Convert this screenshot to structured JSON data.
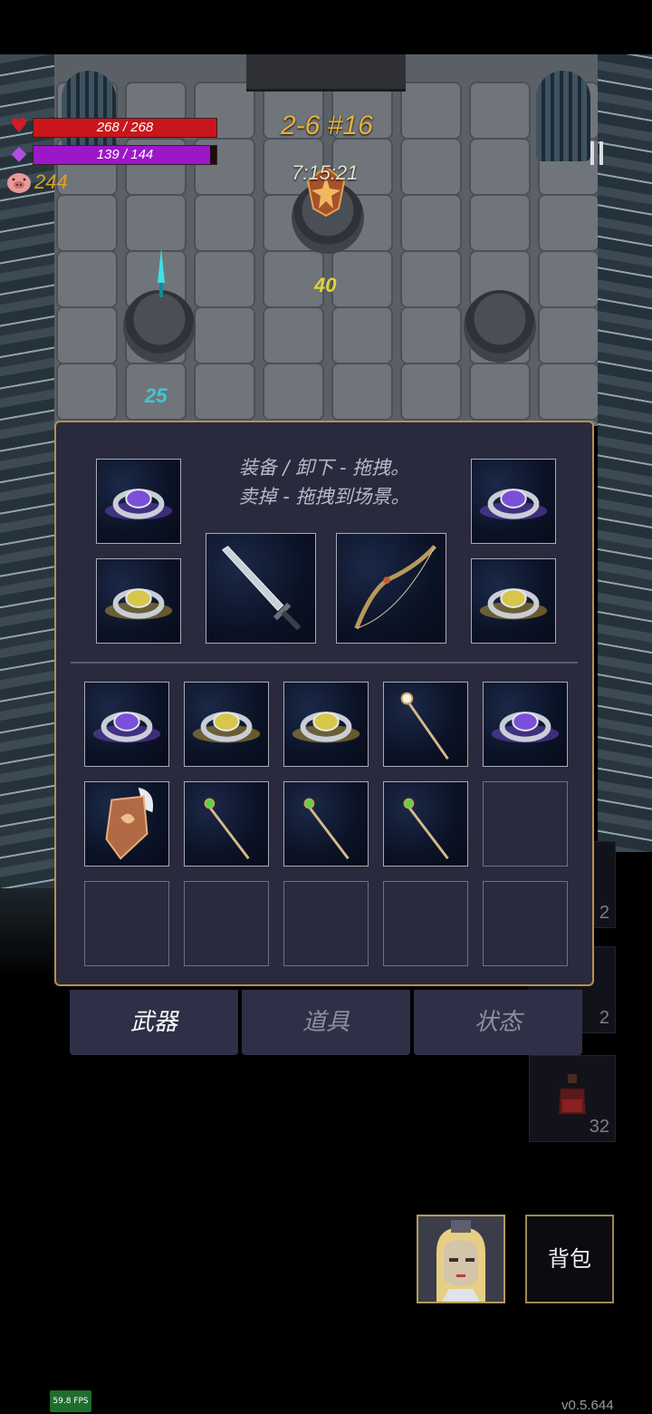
{
  "hud": {
    "hp_text": "268 / 268",
    "hp_fraction": 1.0,
    "mp_text": "139 / 144",
    "mp_fraction": 0.965,
    "gold": "244",
    "stage": "2-6 #16",
    "timer": "7:15:21"
  },
  "scene": {
    "pedestal_left_value": "25",
    "pedestal_center_value": "40"
  },
  "inventory": {
    "hint_line1": "装备 / 卸下 - 拖拽。",
    "hint_line2": "卖掉 - 拖拽到场景。",
    "equipped": [
      "purple-ring",
      "gold-ring",
      "sword",
      "bow",
      "purple-ring",
      "gold-ring"
    ],
    "grid": [
      "purple-ring",
      "gold-ring",
      "gold-ring",
      "staff-white",
      "purple-ring",
      "winged-shield",
      "staff-green",
      "staff-green",
      "staff-green",
      "empty",
      "empty",
      "empty",
      "empty",
      "empty",
      "empty"
    ]
  },
  "tabs": [
    {
      "label": "武器",
      "active": true
    },
    {
      "label": "道具",
      "active": false
    },
    {
      "label": "状态",
      "active": false
    }
  ],
  "side_items": [
    {
      "count": "2"
    },
    {
      "count": "2"
    },
    {
      "count": "32"
    }
  ],
  "bottom": {
    "bag_label": "背包",
    "fps": "59.8 FPS",
    "version": "v0.5.644"
  },
  "colors": {
    "hp": "#c8161c",
    "mp": "#9b17c8",
    "gold": "#d8a322",
    "panel_border": "#b8904e",
    "tab_active_text": "#ffffff",
    "tab_inactive_text": "#8e8ea0"
  }
}
